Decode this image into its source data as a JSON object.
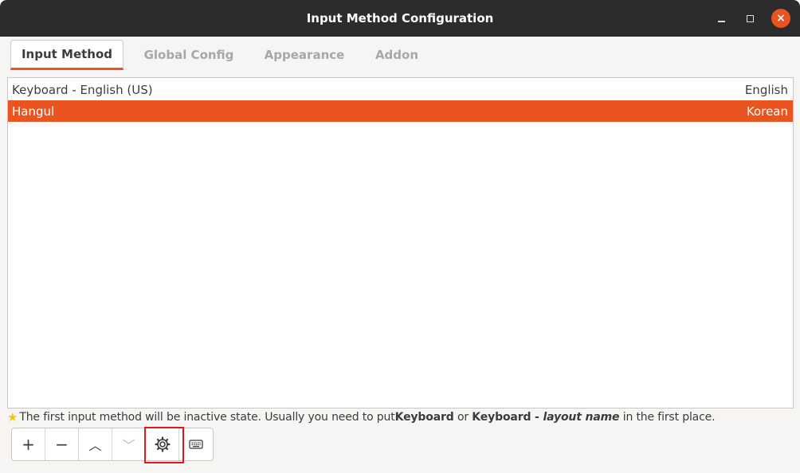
{
  "window": {
    "title": "Input Method Configuration",
    "close_glyph": "×"
  },
  "tabs": [
    {
      "label": "Input Method",
      "active": true
    },
    {
      "label": "Global Config",
      "active": false
    },
    {
      "label": "Appearance",
      "active": false
    },
    {
      "label": "Addon",
      "active": false
    }
  ],
  "input_methods": [
    {
      "name": "Keyboard - English (US)",
      "language": "English",
      "selected": false
    },
    {
      "name": "Hangul",
      "language": "Korean",
      "selected": true
    }
  ],
  "hint": {
    "star_icon": "star-icon",
    "text1": "The first input method will be inactive state. Usually you need to put ",
    "bold1": "Keyboard",
    "text2": " or ",
    "bold2": "Keyboard - ",
    "bold_italic": "layout name",
    "text3": " in the first place."
  },
  "toolbar": {
    "add_glyph": "+",
    "remove_glyph": "−",
    "up_glyph": "︿",
    "down_glyph": "﹀"
  },
  "colors": {
    "accent": "#e95420",
    "titlebar": "#2c2c2c",
    "highlight_box": "#e8141b"
  }
}
